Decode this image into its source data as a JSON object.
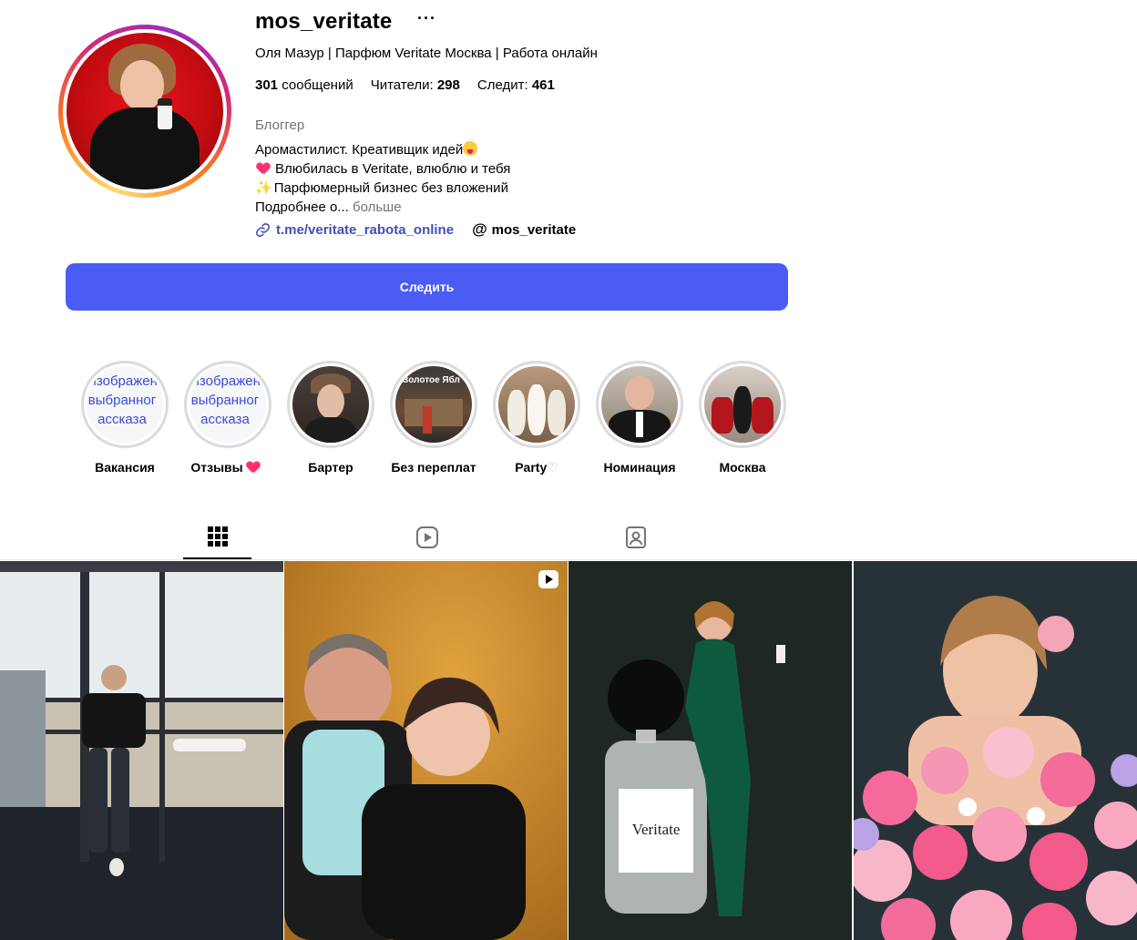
{
  "profile": {
    "username": "mos_veritate",
    "more_label": "···",
    "full_name": "Оля Мазур | Парфюм Veritate Москва | Работа онлайн",
    "stats": {
      "posts_count": "301",
      "posts_label": "сообщений",
      "followers_label": "Читатели:",
      "followers_count": "298",
      "following_label": "Следит:",
      "following_count": "461"
    },
    "category": "Блоггер",
    "bio": {
      "line1": "Аромастилист. Креативщик идей",
      "line2": "Влюбилась в Veritate, влюблю и тебя",
      "line3": "Парфюмерный бизнес без вложений",
      "line4": "Подробнее о...",
      "more": "больше"
    },
    "link_text": "t.me/veritate_rabota_online",
    "threads_handle": "mos_veritate",
    "follow_label": "Следить"
  },
  "highlights": [
    {
      "label": "Вакансия",
      "broken_alt": [
        "Изображен",
        "выбранног",
        "ассказа"
      ]
    },
    {
      "label": "Отзывы",
      "emoji": "heart",
      "broken_alt": [
        "Изображен",
        "выбранног",
        "ассказа"
      ]
    },
    {
      "label": "Бартер"
    },
    {
      "label": "Без переплат"
    },
    {
      "label": "Party",
      "emoji_char": "♡"
    },
    {
      "label": "Номинация"
    },
    {
      "label": "Москва"
    }
  ],
  "story_texts": {
    "bez_pereplat": "Золотое Ябл"
  },
  "post_texts": {
    "bottle_label": "Veritate"
  },
  "icons": [
    "grid-icon",
    "reels-icon",
    "tagged-icon",
    "link-icon",
    "threads-icon"
  ],
  "colors": {
    "follow_button": "#4a5cf4",
    "link": "#3f51b5",
    "secondary_text": "#737373"
  }
}
